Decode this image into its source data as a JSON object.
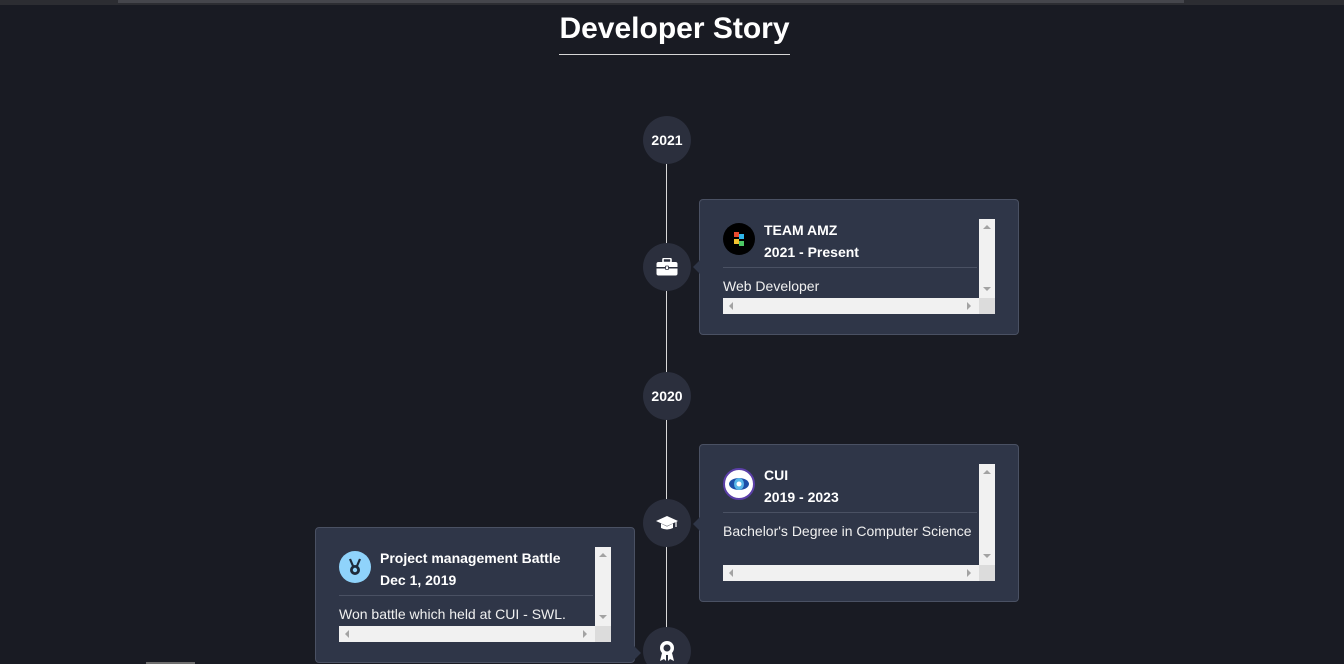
{
  "page": {
    "title": "Developer Story"
  },
  "colors": {
    "background": "#191b23",
    "card": "#2f3648",
    "circle": "#2b2f3d",
    "line": "#d9d9d9"
  },
  "timeline": {
    "years": [
      "2021",
      "2020"
    ],
    "items": [
      {
        "icon": "briefcase-icon",
        "logo": "team-amz-logo",
        "title": "TEAM AMZ",
        "period": "2021 - Present",
        "description": "Web Developer"
      },
      {
        "icon": "graduation-cap-icon",
        "logo": "cui-logo",
        "title": "CUI",
        "period": "2019 - 2023",
        "description": "Bachelor's Degree in Computer Science"
      },
      {
        "icon": "award-icon",
        "logo": "medal-logo",
        "title": "Project management Battle",
        "period": "Dec 1, 2019",
        "description": "Won battle which held at CUI - SWL."
      }
    ]
  }
}
